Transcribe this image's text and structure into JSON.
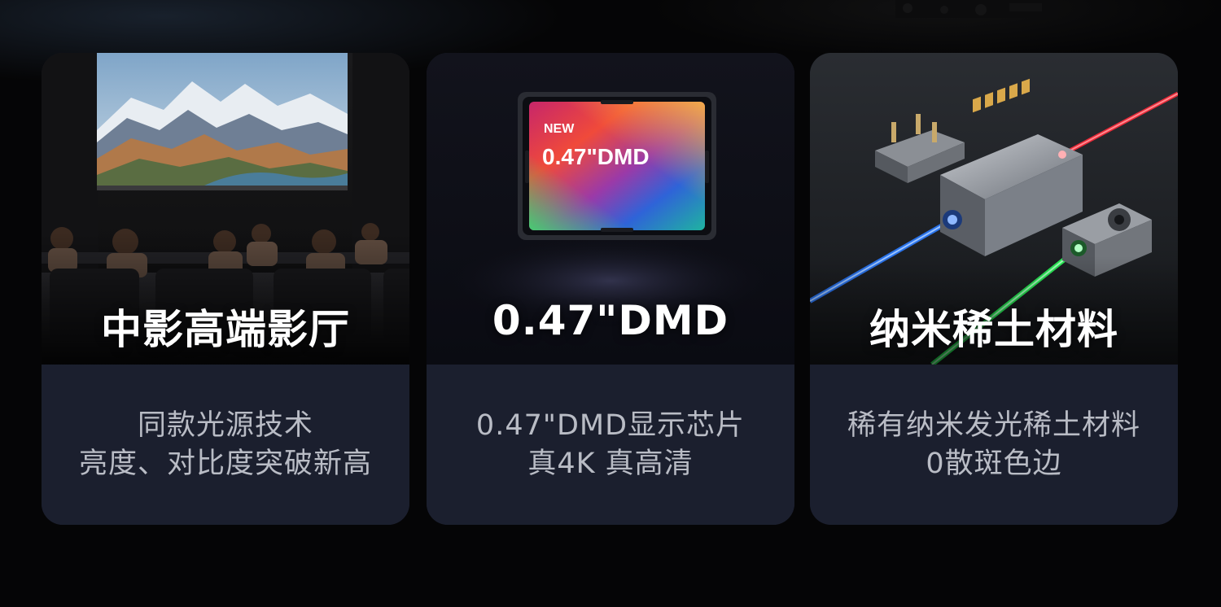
{
  "cards": [
    {
      "title": "中影高端影厅",
      "desc_line1": "同款光源技术",
      "desc_line2": "亮度、对比度突破新高"
    },
    {
      "title": "0.47\"DMD",
      "chip_badge": "NEW",
      "chip_label": "0.47\"DMD",
      "desc_line1": "0.47\"DMD显示芯片",
      "desc_line2": "真4K 真高清"
    },
    {
      "title": "纳米稀土材料",
      "desc_line1": "稀有纳米发光稀土材料",
      "desc_line2": "0散斑色边"
    }
  ],
  "colors": {
    "page_background": "#050506",
    "card_description_background": "#1b1f2e",
    "title_text": "#ffffff",
    "description_text": "#b9bcc5",
    "laser_red": "#ff2a3a",
    "laser_green": "#2bff5a",
    "laser_blue": "#2b7bff"
  }
}
